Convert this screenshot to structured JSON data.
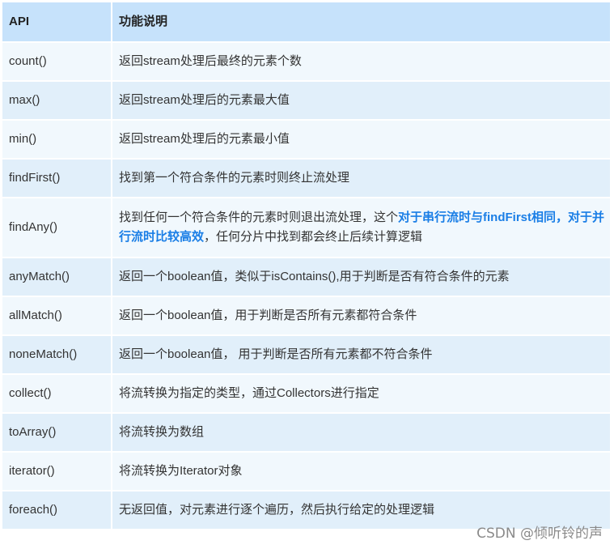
{
  "header": {
    "col_api": "API",
    "col_desc": "功能说明"
  },
  "rows": [
    {
      "api": "count()",
      "desc": "返回stream处理后最终的元素个数"
    },
    {
      "api": "max()",
      "desc": "返回stream处理后的元素最大值"
    },
    {
      "api": "min()",
      "desc": "返回stream处理后的元素最小值"
    },
    {
      "api": "findFirst()",
      "desc": "找到第一个符合条件的元素时则终止流处理"
    },
    {
      "api": "findAny()",
      "desc_before": "找到任何一个符合条件的元素时则退出流处理，这个",
      "desc_highlight": "对于串行流时与findFirst相同，对于并行流时比较高效",
      "desc_after": "，任何分片中找到都会终止后续计算逻辑"
    },
    {
      "api": "anyMatch()",
      "desc": "返回一个boolean值，类似于isContains(),用于判断是否有符合条件的元素"
    },
    {
      "api": "allMatch()",
      "desc": "返回一个boolean值，用于判断是否所有元素都符合条件"
    },
    {
      "api": "noneMatch()",
      "desc": "返回一个boolean值， 用于判断是否所有元素都不符合条件"
    },
    {
      "api": "collect()",
      "desc": "将流转换为指定的类型，通过Collectors进行指定"
    },
    {
      "api": "toArray()",
      "desc": "将流转换为数组"
    },
    {
      "api": "iterator()",
      "desc": "将流转换为Iterator对象"
    },
    {
      "api": "foreach()",
      "desc": "无返回值，对元素进行逐个遍历，然后执行给定的处理逻辑"
    }
  ],
  "watermark": "CSDN @倾听铃的声",
  "colors": {
    "header_bg": "#c6e2fb",
    "row_light": "#f1f8fd",
    "row_dark": "#e1effa",
    "highlight": "#1a7ee6"
  }
}
